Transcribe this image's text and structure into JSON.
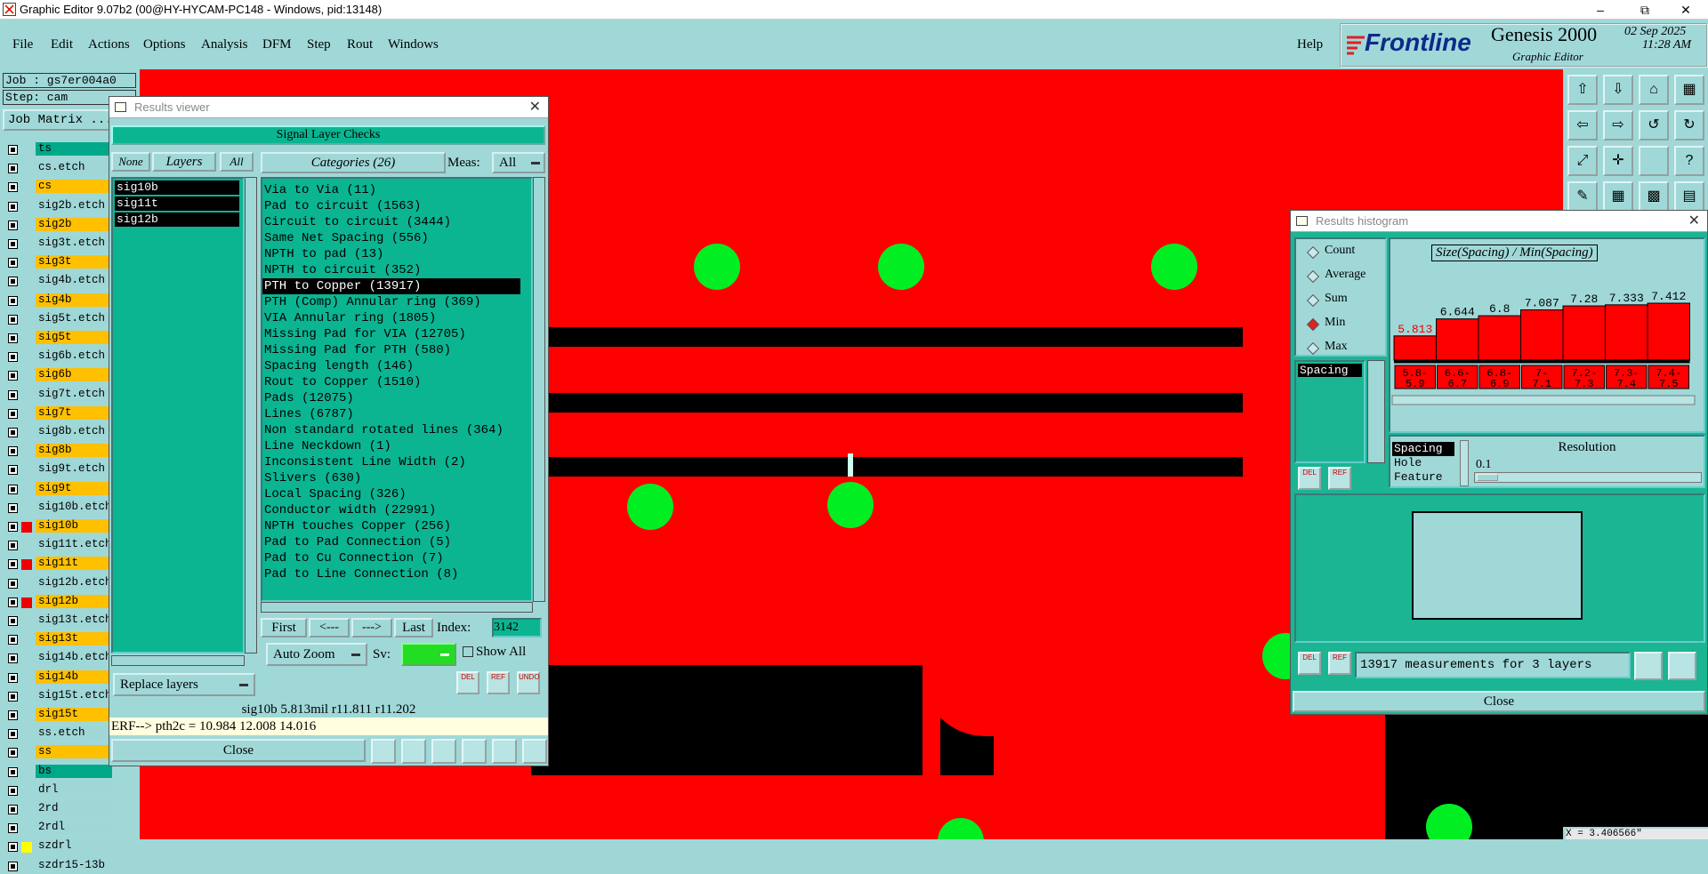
{
  "window": {
    "title": "Graphic Editor 9.07b2 (00@HY-HYCAM-PC148 - Windows, pid:13148)"
  },
  "menu": {
    "items": [
      "File",
      "Edit",
      "Actions",
      "Options",
      "Analysis",
      "DFM",
      "Step",
      "Rout",
      "Windows"
    ],
    "help": "Help"
  },
  "brand": {
    "logo": "Frontline",
    "product": "Genesis 2000",
    "subtitle": "Graphic Editor",
    "date": "02 Sep 2025",
    "time": "11:28 AM"
  },
  "job": {
    "job_label": "Job : gs7er004a0",
    "step_label": "Step: cam",
    "matrix_button": "Job Matrix ..."
  },
  "layers": [
    {
      "name": "ts",
      "color": "#00a88a"
    },
    {
      "name": "cs.etch",
      "color": "#9fd6d6"
    },
    {
      "name": "cs",
      "color": "#ffc000"
    },
    {
      "name": "sig2b.etch",
      "color": "#9fd6d6"
    },
    {
      "name": "sig2b",
      "color": "#ffc000"
    },
    {
      "name": "sig3t.etch",
      "color": "#9fd6d6"
    },
    {
      "name": "sig3t",
      "color": "#ffc000"
    },
    {
      "name": "sig4b.etch",
      "color": "#9fd6d6"
    },
    {
      "name": "sig4b",
      "color": "#ffc000"
    },
    {
      "name": "sig5t.etch",
      "color": "#9fd6d6"
    },
    {
      "name": "sig5t",
      "color": "#ffc000"
    },
    {
      "name": "sig6b.etch",
      "color": "#9fd6d6"
    },
    {
      "name": "sig6b",
      "color": "#ffc000"
    },
    {
      "name": "sig7t.etch",
      "color": "#9fd6d6"
    },
    {
      "name": "sig7t",
      "color": "#ffc000"
    },
    {
      "name": "sig8b.etch",
      "color": "#9fd6d6"
    },
    {
      "name": "sig8b",
      "color": "#ffc000"
    },
    {
      "name": "sig9t.etch",
      "color": "#9fd6d6"
    },
    {
      "name": "sig9t",
      "color": "#ffc000"
    },
    {
      "name": "sig10b.etch",
      "color": "#9fd6d6"
    },
    {
      "name": "sig10b",
      "color": "#ffc000"
    },
    {
      "name": "sig11t.etch",
      "color": "#9fd6d6"
    },
    {
      "name": "sig11t",
      "color": "#ffc000"
    },
    {
      "name": "sig12b.etch",
      "color": "#9fd6d6"
    },
    {
      "name": "sig12b",
      "color": "#ffc000"
    },
    {
      "name": "sig13t.etch",
      "color": "#9fd6d6"
    },
    {
      "name": "sig13t",
      "color": "#ffc000"
    },
    {
      "name": "sig14b.etch",
      "color": "#9fd6d6"
    },
    {
      "name": "sig14b",
      "color": "#ffc000"
    },
    {
      "name": "sig15t.etch",
      "color": "#9fd6d6"
    },
    {
      "name": "sig15t",
      "color": "#ffc000"
    },
    {
      "name": "ss.etch",
      "color": "#9fd6d6"
    },
    {
      "name": "ss",
      "color": "#ffc000"
    },
    {
      "name": "bs",
      "color": "#00a88a"
    },
    {
      "name": "drl",
      "color": "#9fd6d6"
    },
    {
      "name": "2rd",
      "color": "#9fd6d6"
    },
    {
      "name": "2rdl",
      "color": "#9fd6d6"
    },
    {
      "name": "szdrl",
      "color": "#9fd6d6"
    },
    {
      "name": "szdr15-13b",
      "color": "#9fd6d6"
    }
  ],
  "results_viewer": {
    "title": "Results viewer",
    "header": "Signal Layer Checks",
    "none_btn": "None",
    "layers_label": "Layers",
    "all_btn": "All",
    "categories_label": "Categories (26)",
    "meas_label": "Meas:",
    "meas_value": "All",
    "layer_list": [
      "sig10b",
      "sig11t",
      "sig12b"
    ],
    "categories": [
      "Via to Via (11)",
      "Pad to circuit (1563)",
      "Circuit to circuit (3444)",
      "Same Net Spacing (556)",
      "NPTH to pad (13)",
      "NPTH to circuit (352)",
      "PTH to Copper (13917)",
      "PTH (Comp) Annular ring (369)",
      "VIA Annular ring (1805)",
      "Missing Pad for VIA (12705)",
      "Missing Pad for PTH (580)",
      "Spacing length (146)",
      "Rout to Copper (1510)",
      "Pads (12075)",
      "Lines (6787)",
      "Non standard rotated lines (364)",
      "Line Neckdown (1)",
      "Inconsistent Line Width (2)",
      "Slivers (630)",
      "Local Spacing (326)",
      "Conductor width (22991)",
      "NPTH touches Copper (256)",
      "Pad to Pad Connection (5)",
      "Pad to Cu Connection (7)",
      "Pad to Line Connection (8)"
    ],
    "selected_index": 6,
    "first": "First",
    "prev": "<---",
    "next": "--->",
    "last": "Last",
    "index_label": "Index:",
    "index_value": "3142",
    "zoom": "Auto Zoom",
    "sv_label": "Sv:",
    "show_all": "Show All",
    "replace": "Replace layers",
    "status": "sig10b 5.813mil   r11.811   r11.202",
    "erf": "ERF--> pth2c = 10.984 12.008 14.016",
    "close": "Close",
    "btn_del": "DEL",
    "btn_ref": "REF",
    "btn_undo": "UNDO"
  },
  "histogram": {
    "title": "Results histogram",
    "options": [
      "Count",
      "Average",
      "Sum",
      "Min",
      "Max"
    ],
    "selected_option": "Min",
    "chart_title": "Size(Spacing) / Min(Spacing)",
    "field_list": [
      "Spacing"
    ],
    "sort_list": [
      "Spacing",
      "Hole",
      "Feature"
    ],
    "resolution_label": "Resolution",
    "resolution_value": "0.1",
    "status": "13917 measurements for 3 layers",
    "close": "Close",
    "btn_del": "DEL",
    "btn_ref": "REF"
  },
  "chart_data": {
    "type": "bar",
    "categories": [
      "5.8-5.9",
      "6.6-6.7",
      "6.8-6.9",
      "7-7.1",
      "7.2-7.3",
      "7.3-7.4",
      "7.4-7.5"
    ],
    "values": [
      5.813,
      6.644,
      6.8,
      7.087,
      7.28,
      7.333,
      7.412
    ],
    "value_labels": [
      "5.813",
      "6.644",
      "6.8",
      "7.087",
      "7.28",
      "7.333",
      "7.412"
    ],
    "title": "Size(Spacing) / Min(Spacing)",
    "xlabel": "",
    "ylabel": "",
    "ylim": [
      0,
      7.5
    ],
    "bar_color": "#ff0000",
    "highlight_color": "#ff0000"
  },
  "coord": {
    "text": "X = 3.406566\""
  }
}
